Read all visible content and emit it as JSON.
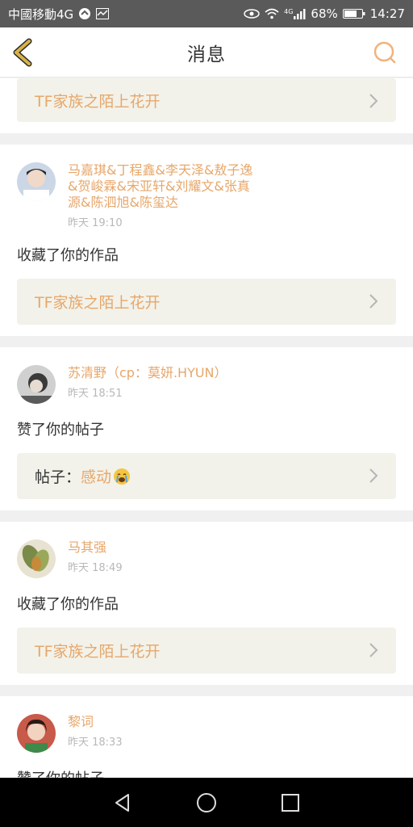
{
  "status_bar": {
    "carrier": "中國移動4G",
    "battery": "68%",
    "signal_label": "4G",
    "time": "14:27"
  },
  "header": {
    "title": "消息"
  },
  "top_link": {
    "text": "TF家族之陌上花开"
  },
  "messages": [
    {
      "user": "马嘉琪&丁程鑫&李天泽&敖子逸&贺峻霖&宋亚轩&刘耀文&张真源&陈泗旭&陈玺达",
      "time": "昨天 19:10",
      "action": "收藏了你的作品",
      "link": {
        "prefix": "",
        "text": "TF家族之陌上花开"
      },
      "avatar_color": "#cbd6e6"
    },
    {
      "user": "苏清野（cp：莫妍.HYUN）",
      "time": "昨天 18:51",
      "action": "赞了你的帖子",
      "link": {
        "prefix": "帖子：",
        "text": "感动"
      },
      "avatar_color": "#8a8a8a"
    },
    {
      "user": "马其强",
      "time": "昨天 18:49",
      "action": "收藏了你的作品",
      "link": {
        "prefix": "",
        "text": "TF家族之陌上花开"
      },
      "avatar_color": "#7a8a48"
    },
    {
      "user": "黎词",
      "time": "昨天 18:33",
      "action": "赞了你的帖子",
      "avatar_color": "#a86c60"
    }
  ],
  "colors": {
    "accent": "#e7a76a",
    "link_bg": "#f2f2ea",
    "status_bar": "#5a5a5a"
  }
}
